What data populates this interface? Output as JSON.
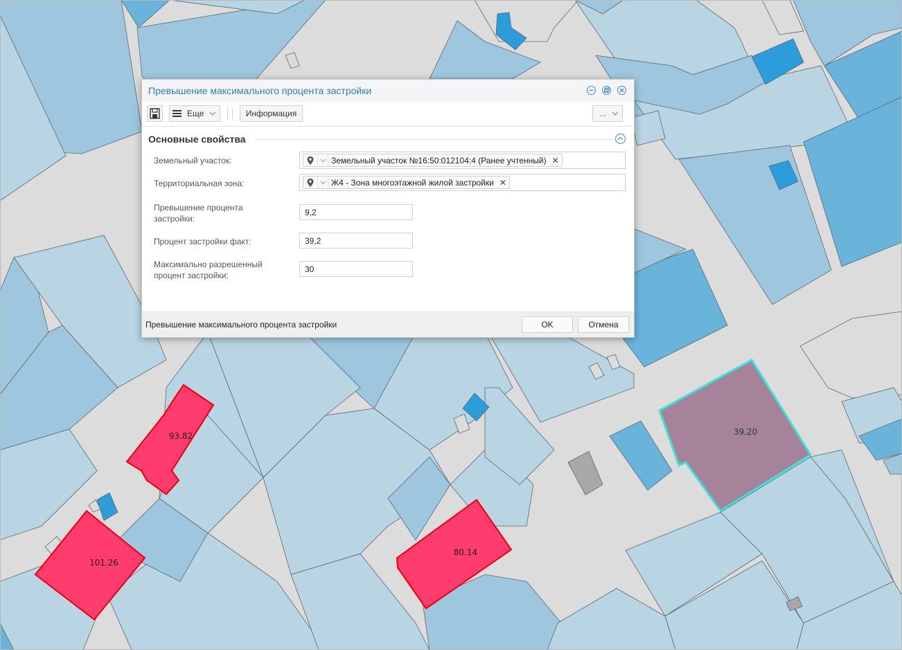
{
  "map": {
    "parcel_labels": [
      "93.82",
      "101.26",
      "80.14",
      "39.20"
    ],
    "colors": {
      "road": "#dcdcdc",
      "parcel_light": "#b9d4e2",
      "parcel_mid": "#9ec7df",
      "building": "#6ab4dc",
      "building_dark": "#2d9cdb",
      "highlight_fill": "#ff3c6e",
      "highlight_stroke": "#e8000b",
      "selected_fill": "#a6839a",
      "selected_stroke": "#3ee0d8",
      "grey_building": "#a8a8a8"
    }
  },
  "dialog": {
    "title": "Превышение максимального процента застройки",
    "toolbar": {
      "more_label": "Еще",
      "info_label": "Информация",
      "overflow_label": "..."
    },
    "section_title": "Основные свойства",
    "fields": {
      "land_plot": {
        "label": "Земельный участок:",
        "value": "Земельный участок №16:50:012104:4 (Ранее учтенный)"
      },
      "territorial_zone": {
        "label": "Территориальная зона:",
        "value": "Ж4 - Зона многоэтажной жилой застройки"
      },
      "excess_percent": {
        "label_line1": "Превышение процента",
        "label_line2": "застройки:",
        "value": "9,2"
      },
      "actual_percent": {
        "label": "Процент застройки факт:",
        "value": "39,2"
      },
      "max_percent": {
        "label_line1": "Максимально разрешенный",
        "label_line2": "процент застройки:",
        "value": "30"
      }
    },
    "footer": {
      "status_text": "Превышение максимального процента застройки",
      "ok_label": "OK",
      "cancel_label": "Отмена"
    }
  }
}
